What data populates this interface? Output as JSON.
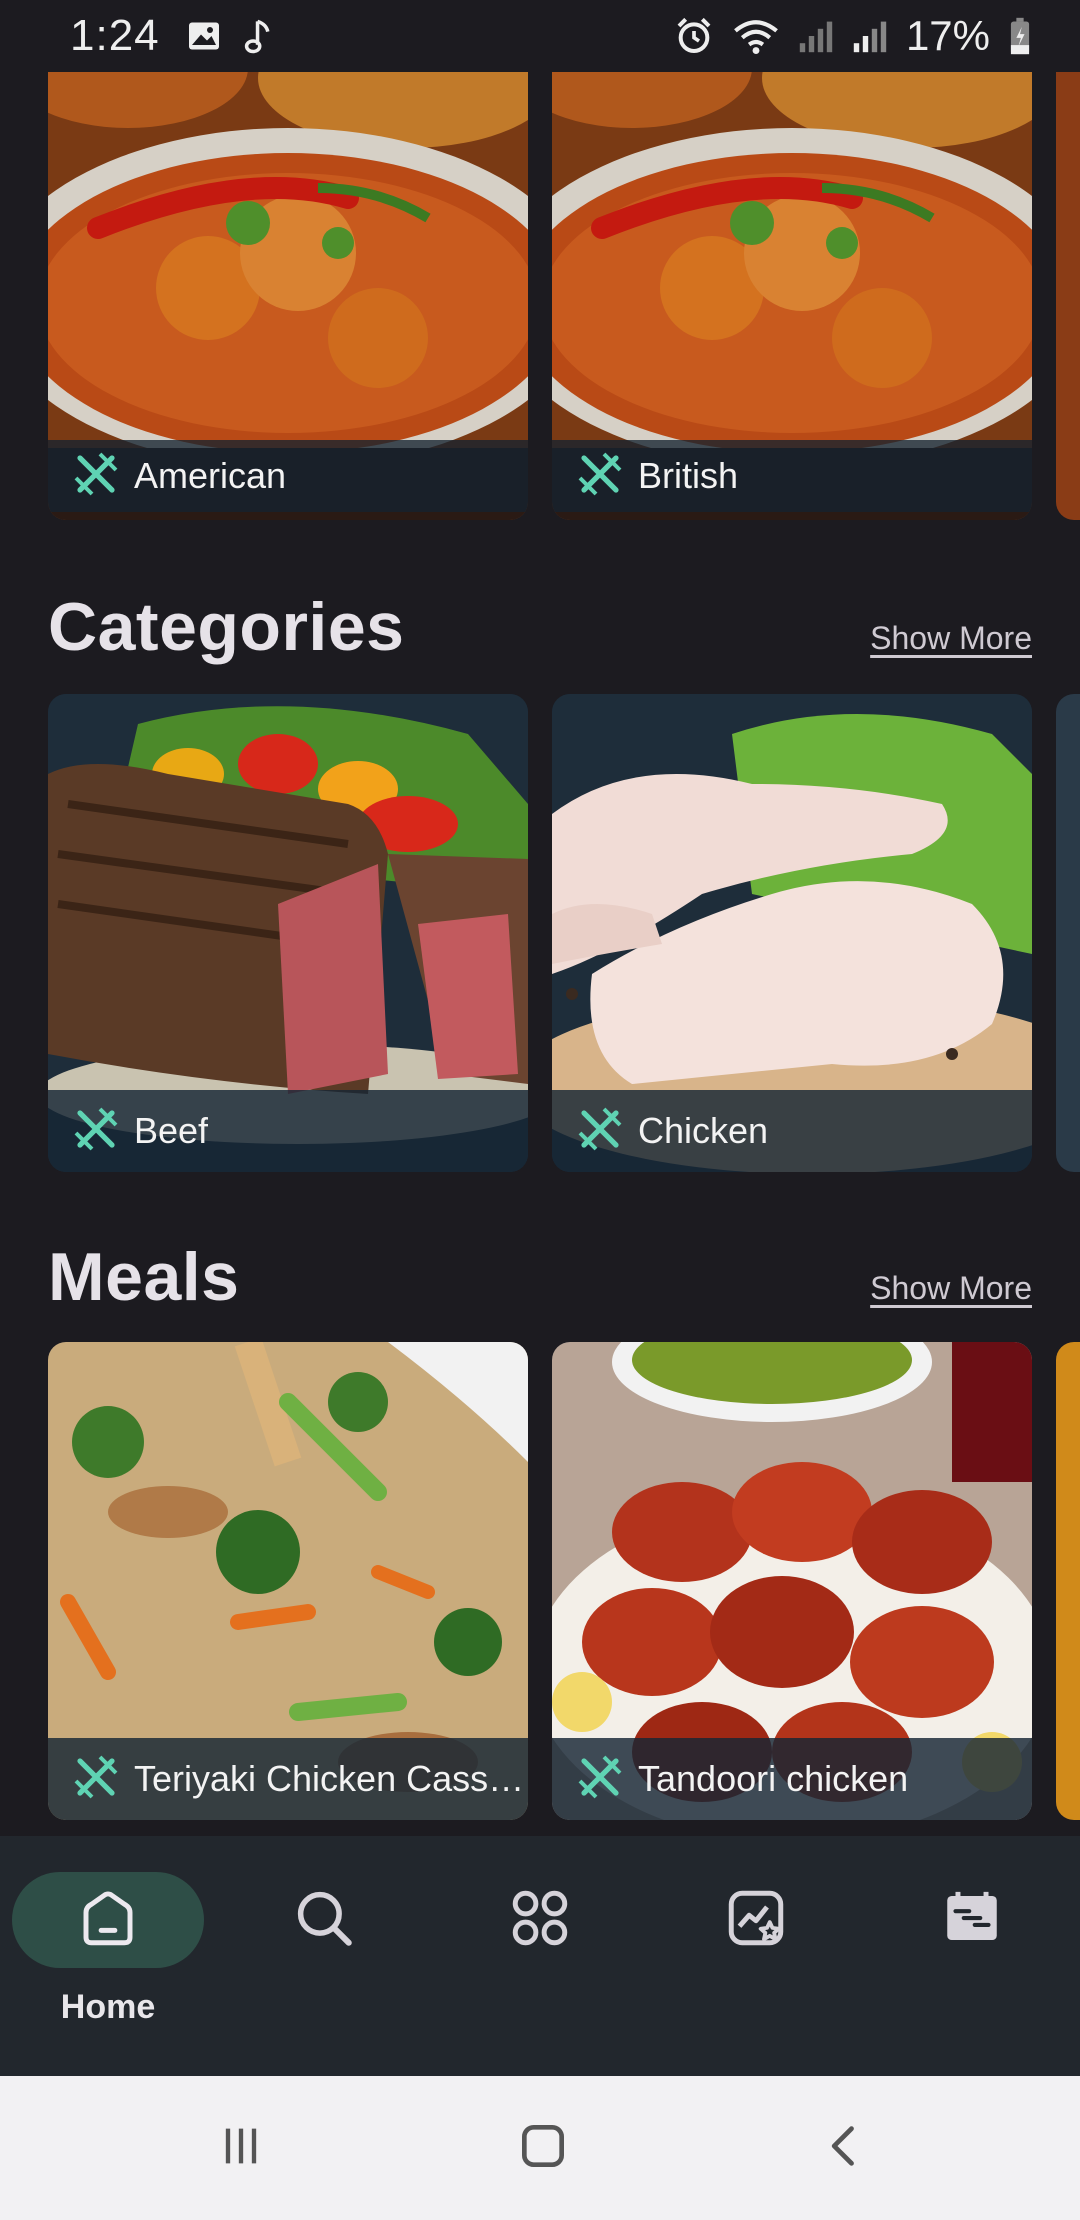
{
  "status_bar": {
    "time": "1:24",
    "battery": "17%",
    "icons": [
      "image-icon",
      "music-note-icon",
      "alarm-icon",
      "wifi-icon",
      "signal-icon",
      "signal-icon",
      "battery-icon"
    ]
  },
  "cuisines": {
    "items": [
      {
        "name": "American",
        "icon": "cutlery-icon"
      },
      {
        "name": "British",
        "icon": "cutlery-icon"
      }
    ]
  },
  "categories": {
    "title": "Categories",
    "show_more": "Show More",
    "items": [
      {
        "name": "Beef",
        "icon": "cutlery-icon"
      },
      {
        "name": "Chicken",
        "icon": "cutlery-icon"
      }
    ]
  },
  "meals": {
    "title": "Meals",
    "show_more": "Show More",
    "items": [
      {
        "name": "Teriyaki Chicken Casserole",
        "icon": "cutlery-icon"
      },
      {
        "name": "Tandoori chicken",
        "icon": "cutlery-icon"
      }
    ]
  },
  "bottom_nav": {
    "items": [
      {
        "label": "Home",
        "icon": "home-icon",
        "active": true
      },
      {
        "label": "",
        "icon": "search-icon",
        "active": false
      },
      {
        "label": "",
        "icon": "grid-icon",
        "active": false
      },
      {
        "label": "",
        "icon": "favorites-icon",
        "active": false
      },
      {
        "label": "",
        "icon": "calendar-icon",
        "active": false
      }
    ]
  },
  "colors": {
    "background": "#1c1b20",
    "accent": "#5fd3b3",
    "active_nav_pill": "#2e4e47",
    "nav_background": "#22272d"
  }
}
